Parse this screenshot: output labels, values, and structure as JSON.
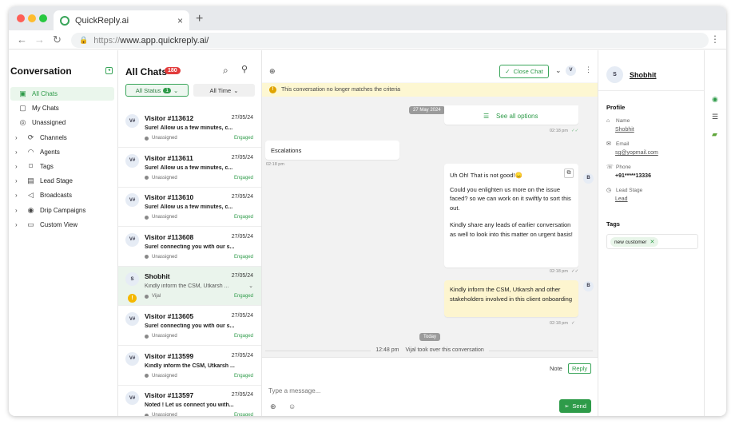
{
  "browser": {
    "tab_title": "QuickReply.ai",
    "tab_close": "×",
    "new_tab": "+",
    "url_scheme": "https://",
    "url_rest": "www.app.quickreply.ai/",
    "back": "←",
    "forward": "→",
    "reload": "↻",
    "menu": "⋮"
  },
  "sidebar": {
    "title": "Conversation",
    "items": [
      {
        "label": "All Chats",
        "icon": "chat-icon",
        "glyph": "▣",
        "expandable": false
      },
      {
        "label": "My Chats",
        "icon": "my-chats-icon",
        "glyph": "▢",
        "expandable": false
      },
      {
        "label": "Unassigned",
        "icon": "unassigned-icon",
        "glyph": "◎",
        "expandable": false
      },
      {
        "label": "Channels",
        "icon": "channels-icon",
        "glyph": "⟳",
        "expandable": true
      },
      {
        "label": "Agents",
        "icon": "headset-icon",
        "glyph": "◠",
        "expandable": true
      },
      {
        "label": "Tags",
        "icon": "tag-icon",
        "glyph": "⌑",
        "expandable": true
      },
      {
        "label": "Lead Stage",
        "icon": "lead-stage-icon",
        "glyph": "▤",
        "expandable": true
      },
      {
        "label": "Broadcasts",
        "icon": "broadcast-icon",
        "glyph": "◁",
        "expandable": true
      },
      {
        "label": "Drip Campaigns",
        "icon": "drip-icon",
        "glyph": "◉",
        "expandable": true
      },
      {
        "label": "Custom View",
        "icon": "custom-view-icon",
        "glyph": "▭",
        "expandable": true
      }
    ]
  },
  "chatlist": {
    "title": "All Chats",
    "count": "180",
    "status_filter": "All Status",
    "status_count": "1",
    "time_filter": "All Time",
    "conversations": [
      {
        "avatar": "V#",
        "name": "Visitor #113612",
        "date": "27/05/24",
        "message": "Sure! Allow us a few minutes, c...",
        "agent": "Unassigned",
        "status": "Engaged"
      },
      {
        "avatar": "V#",
        "name": "Visitor #113611",
        "date": "27/05/24",
        "message": "Sure! Allow us a few minutes, c...",
        "agent": "Unassigned",
        "status": "Engaged"
      },
      {
        "avatar": "V#",
        "name": "Visitor #113610",
        "date": "27/05/24",
        "message": "Sure! Allow us a few minutes, c...",
        "agent": "Unassigned",
        "status": "Engaged"
      },
      {
        "avatar": "V#",
        "name": "Visitor #113608",
        "date": "27/05/24",
        "message": "Sure! connecting you with our s...",
        "agent": "Unassigned",
        "status": "Engaged"
      },
      {
        "avatar": "S",
        "name": "Shobhit",
        "date": "27/05/24",
        "message": "Kindly inform the CSM, Utkarsh ...",
        "agent": "Vijal",
        "status": "Engaged",
        "selected": true
      },
      {
        "avatar": "V#",
        "name": "Visitor #113605",
        "date": "27/05/24",
        "message": "Sure! connecting you with our s...",
        "agent": "Unassigned",
        "status": "Engaged"
      },
      {
        "avatar": "V#",
        "name": "Visitor #113599",
        "date": "27/05/24",
        "message": "Kindly inform the CSM, Utkarsh ...",
        "agent": "Unassigned",
        "status": "Engaged"
      },
      {
        "avatar": "V#",
        "name": "Visitor #113597",
        "date": "27/05/24",
        "message": "Noted ! Let us connect you with...",
        "agent": "Unassigned",
        "status": "Engaged"
      }
    ]
  },
  "chat": {
    "close_chat": "Close Chat",
    "header_avatar": "V",
    "banner": "This conversation no longer matches the criteria",
    "date_pill_1": "27 May 2024",
    "see_all_options": "See all options",
    "ts_1": "02:18 pm",
    "escalations": "Escalations",
    "ts_2": "02:18 pm",
    "bot_msg_1": "Uh Oh! That is not good!😞",
    "bot_msg_2": "Could you enlighten us more on the issue faced? so we can work on it swiftly to sort this out.",
    "bot_msg_3": "Kindly share any leads of earlier conversation as well to look into this matter on urgent basis!",
    "ts_3": "02:18 pm",
    "bot_avatar": "B",
    "note_msg": "Kindly inform the CSM, Utkarsh and other stakeholders involved in this client onboarding",
    "ts_4": "02:18 pm",
    "date_pill_2": "Today",
    "sys_time": "12:48 pm",
    "sys_text": "Vijal took over this conversation",
    "note_tab": "Note",
    "reply_tab": "Reply",
    "input_placeholder": "Type a message...",
    "send": "Send"
  },
  "profile": {
    "avatar": "S",
    "name": "Shobhit",
    "section": "Profile",
    "name_label": "Name",
    "name_value": "Shobhit",
    "email_label": "Email",
    "email_value": "sg@yopmail.com",
    "phone_label": "Phone",
    "phone_value": "+91*****13336",
    "lead_label": "Lead Stage",
    "lead_value": "Lead",
    "tags_title": "Tags",
    "tag": "new customer"
  },
  "colors": {
    "accent": "#2e9b49",
    "badge": "#e23b3b",
    "banner": "#fdf7d2",
    "note": "#fdf5cf"
  }
}
